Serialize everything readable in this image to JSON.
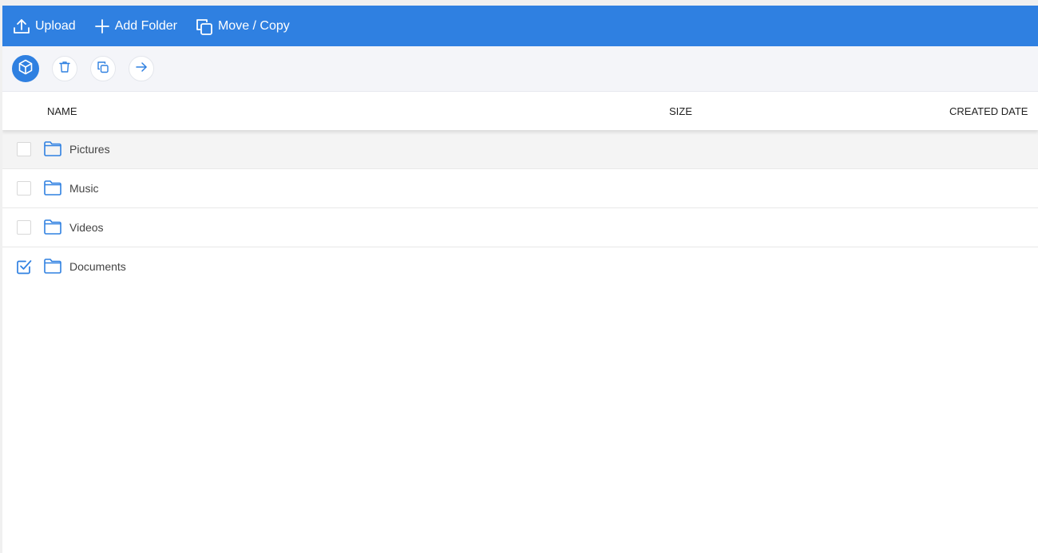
{
  "toolbar": {
    "upload_label": "Upload",
    "add_folder_label": "Add Folder",
    "move_copy_label": "Move / Copy",
    "bg_color": "#2f80e1"
  },
  "actions": {
    "icons": [
      "cube-icon",
      "trash-icon",
      "copy-icon",
      "arrow-right-icon"
    ]
  },
  "table": {
    "columns": [
      "NAME",
      "SIZE",
      "CREATED DATE"
    ],
    "rows": [
      {
        "name": "Pictures",
        "checked": false,
        "hover": true
      },
      {
        "name": "Music",
        "checked": false,
        "hover": false
      },
      {
        "name": "Videos",
        "checked": false,
        "hover": false
      },
      {
        "name": "Documents",
        "checked": true,
        "hover": false
      }
    ]
  }
}
